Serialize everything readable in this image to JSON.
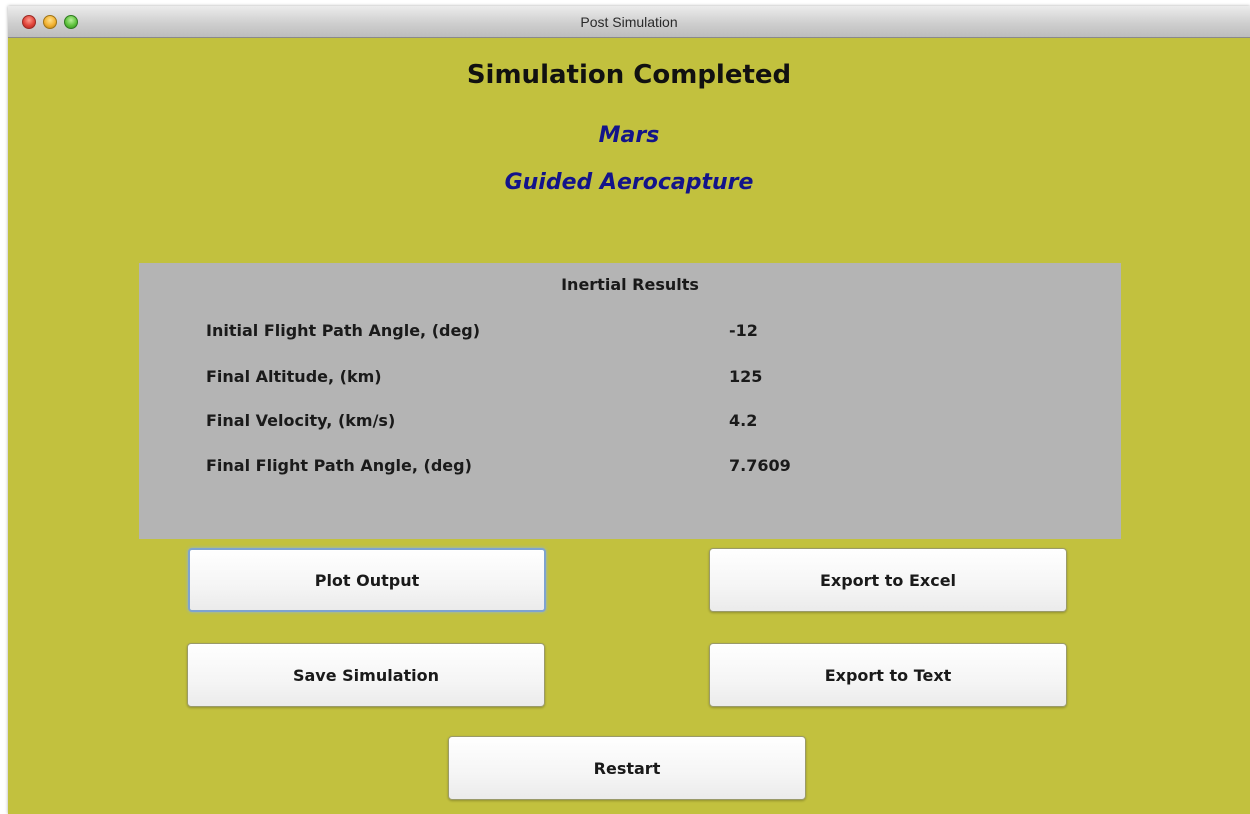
{
  "window": {
    "title": "Post Simulation"
  },
  "header": {
    "heading": "Simulation Completed",
    "planet": "Mars",
    "mission": "Guided Aerocapture"
  },
  "results": {
    "title": "Inertial Results",
    "rows": [
      {
        "label": "Initial Flight Path Angle, (deg)",
        "value": "-12"
      },
      {
        "label": "Final Altitude,  (km)",
        "value": "125"
      },
      {
        "label": "Final Velocity,  (km/s)",
        "value": "4.2"
      },
      {
        "label": "Final Flight Path Angle,  (deg)",
        "value": "7.7609"
      }
    ]
  },
  "buttons": {
    "plot_output": "Plot Output",
    "export_excel": "Export to Excel",
    "save_simulation": "Save Simulation",
    "export_text": "Export to Text",
    "restart": "Restart"
  },
  "colors": {
    "background": "#c2c13e",
    "panel": "#b4b4b4",
    "subtitle": "#13148a",
    "focus_ring": "#7ea3d0"
  }
}
